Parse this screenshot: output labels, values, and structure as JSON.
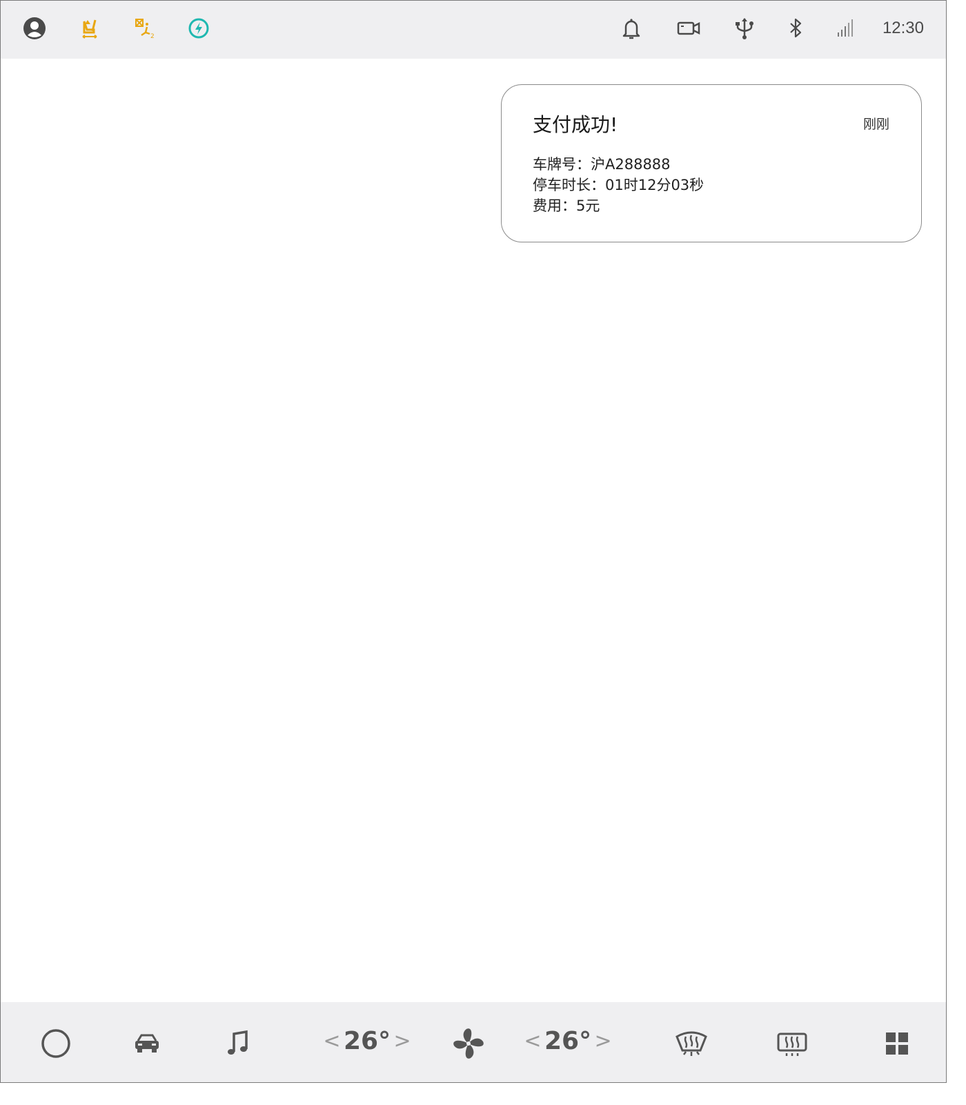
{
  "status_bar": {
    "time": "12:30",
    "left_icons": [
      "user-icon",
      "seat-adjust-icon",
      "passenger-seat-icon",
      "charging-icon"
    ],
    "right_icons": [
      "bell-icon",
      "camera-icon",
      "usb-icon",
      "bluetooth-icon",
      "signal-icon"
    ],
    "colors": {
      "warning": "#e8a713",
      "charging": "#1fb8b0",
      "icon": "#4a4a4a"
    }
  },
  "notification": {
    "title": "支付成功!",
    "time": "刚刚",
    "lines": [
      "车牌号：沪A288888",
      "停车时长：01时12分03秒",
      "费用：5元"
    ]
  },
  "dock": {
    "items": [
      "home-icon",
      "car-icon",
      "music-icon",
      "fan-icon",
      "front-defrost-icon",
      "rear-defrost-icon",
      "apps-grid-icon"
    ],
    "left_temp": {
      "value": "26°",
      "prev": "<",
      "next": ">"
    },
    "right_temp": {
      "value": "26°",
      "prev": "<",
      "next": ">"
    }
  }
}
